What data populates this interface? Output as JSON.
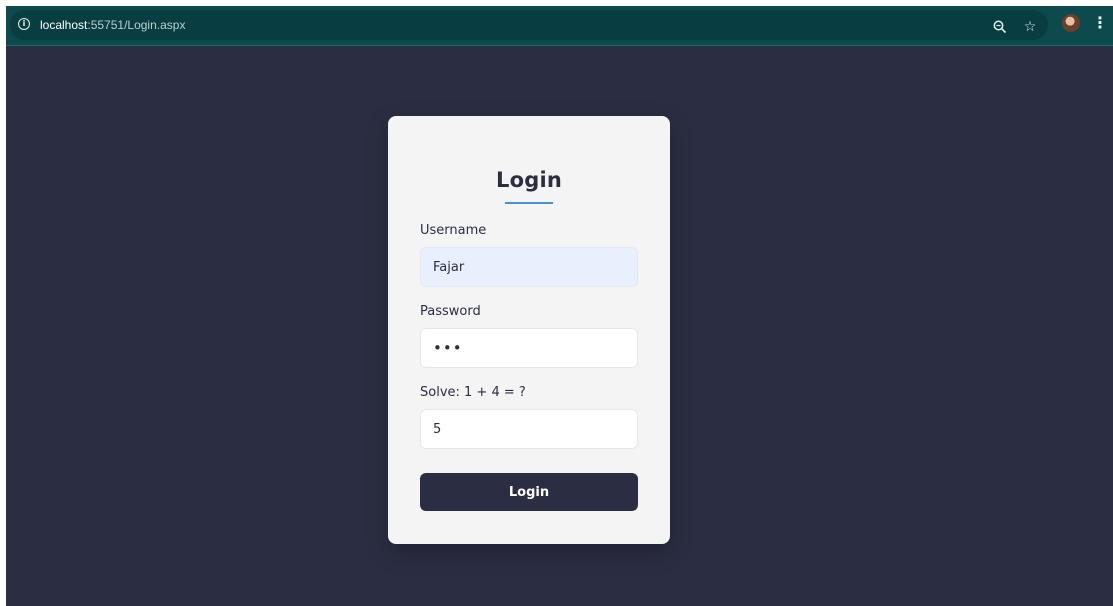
{
  "browser": {
    "url_host": "localhost",
    "url_rest": ":55751/Login.aspx",
    "icons": {
      "info": "info-icon",
      "zoom": "zoom-icon",
      "bookmark": "star-icon",
      "profile": "avatar",
      "menu": "kebab-menu-icon"
    }
  },
  "login": {
    "title": "Login",
    "username_label": "Username",
    "username_value": "Fajar",
    "password_label": "Password",
    "password_value": "•••",
    "captcha_label": "Solve: 1 + 4 = ?",
    "captcha_value": "5",
    "button_label": "Login"
  },
  "colors": {
    "page_background": "#2b2d42",
    "browser_bar": "#0c4a4e",
    "card_background": "#f4f4f5",
    "accent_underline": "#4a90e2",
    "button_background": "#2b2d42",
    "autofill_background": "#e8f0fe"
  }
}
